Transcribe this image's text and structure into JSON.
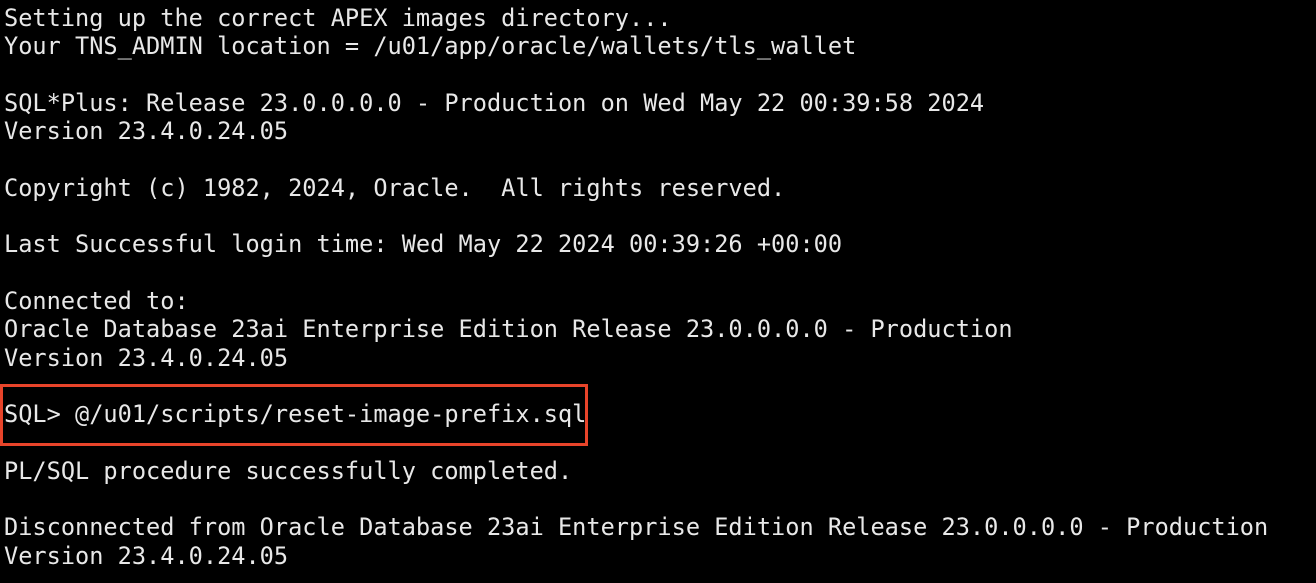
{
  "terminal": {
    "lines": [
      "Setting up the correct APEX images directory...",
      "Your TNS_ADMIN location = /u01/app/oracle/wallets/tls_wallet",
      "",
      "SQL*Plus: Release 23.0.0.0.0 - Production on Wed May 22 00:39:58 2024",
      "Version 23.4.0.24.05",
      "",
      "Copyright (c) 1982, 2024, Oracle.  All rights reserved.",
      "",
      "Last Successful login time: Wed May 22 2024 00:39:26 +00:00",
      "",
      "Connected to:",
      "Oracle Database 23ai Enterprise Edition Release 23.0.0.0.0 - Production",
      "Version 23.4.0.24.05",
      "",
      "SQL> @/u01/scripts/reset-image-prefix.sql",
      "",
      "PL/SQL procedure successfully completed.",
      "",
      "Disconnected from Oracle Database 23ai Enterprise Edition Release 23.0.0.0.0 - Production",
      "Version 23.4.0.24.05"
    ]
  },
  "colors": {
    "background": "#000000",
    "text": "#e8e8e8",
    "highlight_border": "#e8442a"
  }
}
